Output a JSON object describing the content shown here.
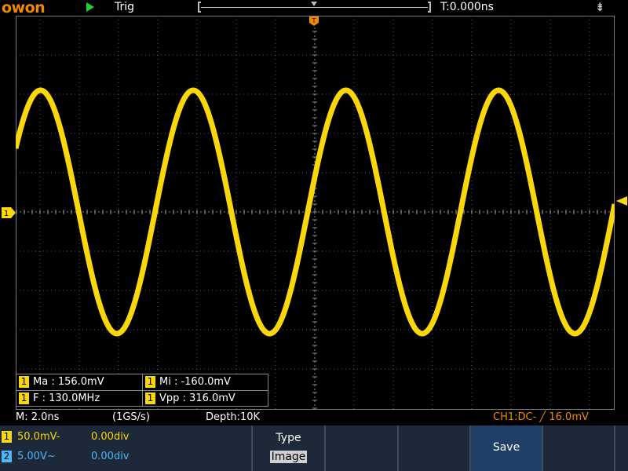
{
  "brand": "owon",
  "top": {
    "run_state_icon": "play-icon",
    "trigger_status": "Trig",
    "trigger_time": "T:0.000ns",
    "usb_icon": "usb-icon"
  },
  "markers": {
    "trigger_position": "T",
    "ch1_ground": "1"
  },
  "measurements": [
    {
      "channel": "1",
      "label": "Ma : 156.0mV"
    },
    {
      "channel": "1",
      "label": "Mi : -160.0mV"
    },
    {
      "channel": "1",
      "label": "F : 130.0MHz"
    },
    {
      "channel": "1",
      "label": "Vpp : 316.0mV"
    }
  ],
  "info": {
    "timebase": "M: 2.0ns",
    "sample_rate": "(1GS/s)",
    "depth": "Depth:10K",
    "trigger": "CH1:DC- ╱ 16.0mV"
  },
  "channels": [
    {
      "num": "1",
      "scale": "50.0mV-",
      "offset": "0.00div",
      "color": "#f9d70b"
    },
    {
      "num": "2",
      "scale": "5.00V~",
      "offset": "0.00div",
      "color": "#4bb7ff"
    }
  ],
  "menu": {
    "type_title": "Type",
    "type_value": "Image",
    "save_label": "Save"
  },
  "colors": {
    "trace": "#f9d70b",
    "ch2": "#4bb7ff",
    "brand": "#f08a00",
    "menu_bg": "#1d2838",
    "active_key": "#1f3f66"
  },
  "signal": {
    "waveform": "sine",
    "frequency": "130.0MHz",
    "max": "156.0mV",
    "min": "-160.0mV",
    "vpp": "316.0mV"
  }
}
